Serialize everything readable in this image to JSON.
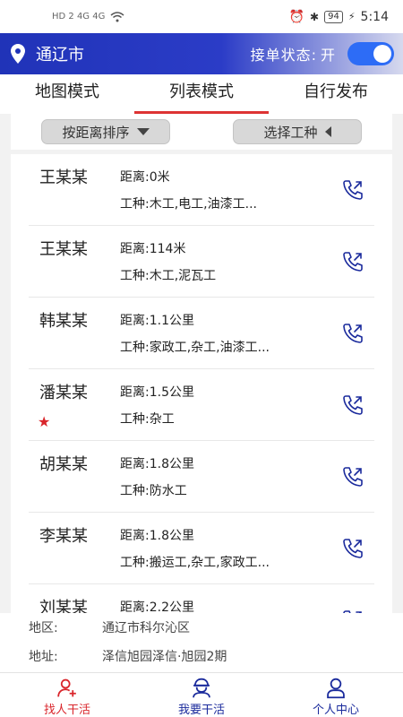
{
  "status_bar": {
    "left_indicators": "HD 2  4G  4G",
    "battery": "94",
    "time": "5:14"
  },
  "header": {
    "city": "通辽市",
    "order_status_label": "接单状态:",
    "order_status_value": "开",
    "toggle_on": true,
    "accent_color": "#2033b8"
  },
  "tabs": [
    {
      "label": "地图模式",
      "active": false
    },
    {
      "label": "列表模式",
      "active": true
    },
    {
      "label": "自行发布",
      "active": false
    }
  ],
  "filters": {
    "sort_label": "按距离排序",
    "type_label": "选择工种"
  },
  "workers": [
    {
      "name": "王某某",
      "distance_label": "距离:",
      "distance": "0米",
      "trade_label": "工种:",
      "trade": "木工,电工,油漆工...",
      "starred": false
    },
    {
      "name": "王某某",
      "distance_label": "距离:",
      "distance": "114米",
      "trade_label": "工种:",
      "trade": "木工,泥瓦工",
      "starred": false
    },
    {
      "name": "韩某某",
      "distance_label": "距离:",
      "distance": "1.1公里",
      "trade_label": "工种:",
      "trade": "家政工,杂工,油漆工...",
      "starred": false
    },
    {
      "name": "潘某某",
      "distance_label": "距离:",
      "distance": "1.5公里",
      "trade_label": "工种:",
      "trade": "杂工",
      "starred": true
    },
    {
      "name": "胡某某",
      "distance_label": "距离:",
      "distance": "1.8公里",
      "trade_label": "工种:",
      "trade": "防水工",
      "starred": false
    },
    {
      "name": "李某某",
      "distance_label": "距离:",
      "distance": "1.8公里",
      "trade_label": "工种:",
      "trade": "搬运工,杂工,家政工...",
      "starred": false
    },
    {
      "name": "刘某某",
      "distance_label": "距离:",
      "distance": "2.2公里",
      "trade_label": "",
      "trade": "",
      "starred": false
    }
  ],
  "location_info": {
    "region_label": "地区:",
    "region": "通辽市科尔沁区",
    "address_label": "地址:",
    "address": "泽信旭园泽信·旭园2期"
  },
  "bottom_nav": [
    {
      "label": "找人干活",
      "icon": "user-add-icon",
      "color": "#d9252b"
    },
    {
      "label": "我要干活",
      "icon": "worker-icon",
      "color": "#1a2a9c"
    },
    {
      "label": "个人中心",
      "icon": "user-icon",
      "color": "#1a2a9c"
    }
  ]
}
